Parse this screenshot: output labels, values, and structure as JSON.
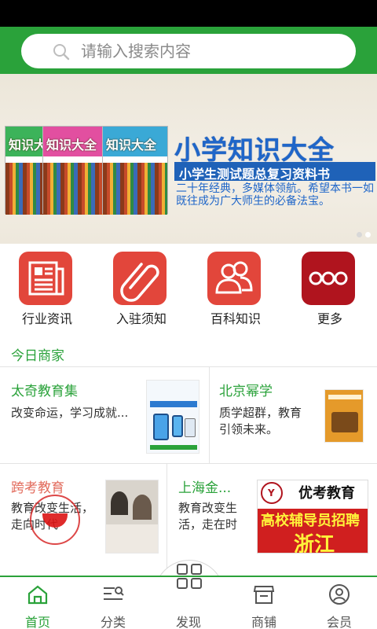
{
  "search": {
    "placeholder": "请输入搜索内容"
  },
  "banner": {
    "book_word": "知识大全",
    "title": "小学知识大全",
    "subtitle": "小学生测试题总复习资料书",
    "description": "二十年经典，多媒体领航。希望本书一如既往成为广大师生的必备法宝。"
  },
  "quick_nav": [
    {
      "label": "行业资讯",
      "icon": "newspaper-icon",
      "color": "#e2463b"
    },
    {
      "label": "入驻须知",
      "icon": "paperclip-icon",
      "color": "#e2463b"
    },
    {
      "label": "百科知识",
      "icon": "users-icon",
      "color": "#e2463b"
    },
    {
      "label": "更多",
      "icon": "more-icon",
      "color": "#b0141e"
    }
  ],
  "section": {
    "title": "今日商家"
  },
  "merchants": [
    {
      "title": "太奇教育集",
      "desc": "改变命运，学习成就..."
    },
    {
      "title": "北京幂学",
      "desc": "质学超群，教育引领未来。"
    },
    {
      "title": "跨考教育",
      "desc": "教育改变生活，走向时代"
    },
    {
      "title": "上海金...",
      "desc": "教育改变生活，走在时"
    }
  ],
  "ads": {
    "youkao_name": "优考教育",
    "youkao_recruit": "高校辅导员招聘",
    "youkao_region": "浙江"
  },
  "bottom_nav": [
    {
      "label": "首页",
      "icon": "home-icon",
      "active": true
    },
    {
      "label": "分类",
      "icon": "category-icon",
      "active": false
    },
    {
      "label": "发现",
      "icon": "grid-icon",
      "active": false
    },
    {
      "label": "商铺",
      "icon": "shop-icon",
      "active": false
    },
    {
      "label": "会员",
      "icon": "user-icon",
      "active": false
    }
  ],
  "colors": {
    "brand": "#2aa23a",
    "accent": "#e2463b"
  }
}
